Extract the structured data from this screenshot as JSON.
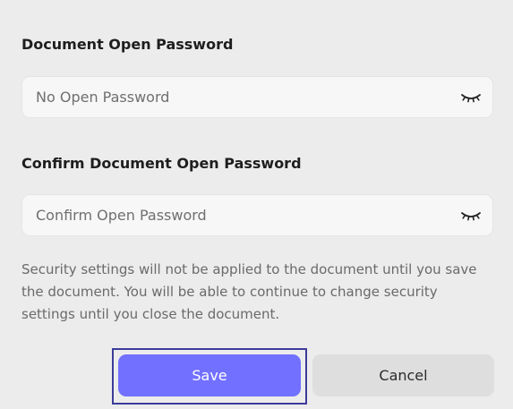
{
  "open_password": {
    "label": "Document Open Password",
    "placeholder": "No Open Password",
    "value": "",
    "visibility_icon": "eye-closed-icon"
  },
  "confirm_password": {
    "label": "Confirm Document Open Password",
    "placeholder": "Confirm Open Password",
    "value": "",
    "visibility_icon": "eye-closed-icon"
  },
  "note": "Security settings will not be applied to the document until you save the document. You will be able to continue to change security settings until you close the document.",
  "buttons": {
    "save_label": "Save",
    "cancel_label": "Cancel"
  },
  "colors": {
    "background": "#ececec",
    "primary": "#7270ff",
    "focus_ring": "#3c3c9a",
    "secondary_button": "#dedede"
  }
}
